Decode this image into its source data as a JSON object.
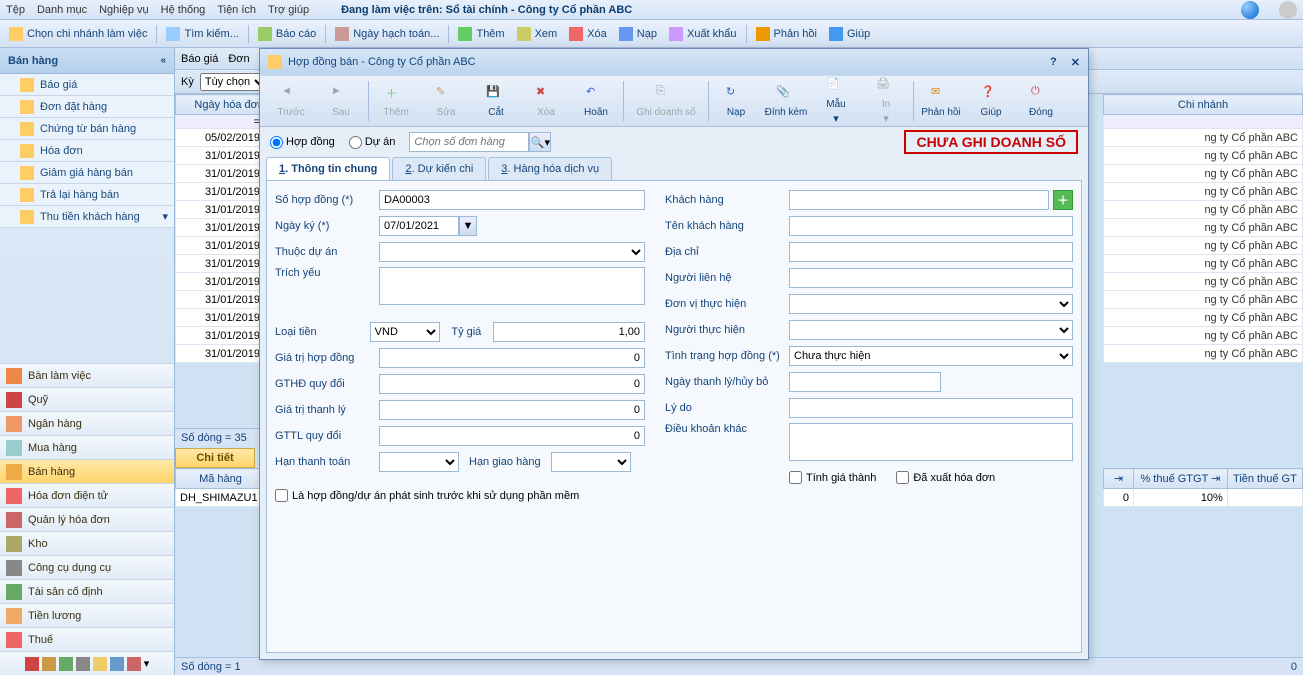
{
  "menubar": {
    "items": [
      "Tệp",
      "Danh mục",
      "Nghiệp vụ",
      "Hệ thống",
      "Tiện ích",
      "Trợ giúp"
    ],
    "context_prefix": "Đang làm việc trên: ",
    "context_value": "Sổ tài chính - Công ty Cổ phần ABC"
  },
  "toolbar": {
    "branch": "Chọn chi nhánh làm việc",
    "search": "Tìm kiếm...",
    "report": "Báo cáo",
    "accounting_date": "Ngày hạch toán...",
    "add": "Thêm",
    "view": "Xem",
    "delete": "Xóa",
    "reload": "Nạp",
    "export": "Xuất khẩu",
    "feedback": "Phản hồi",
    "help": "Giúp"
  },
  "sidebar": {
    "title": "Bán hàng",
    "subs": [
      "Báo giá",
      "Đơn đặt hàng",
      "Chứng từ bán hàng",
      "Hóa đơn",
      "Giảm giá hàng bán",
      "Trả lại hàng bán",
      "Thu tiền khách hàng"
    ],
    "sections": [
      "Bàn làm việc",
      "Quỹ",
      "Ngân hàng",
      "Mua hàng",
      "Bán hàng",
      "Hóa đơn điện tử",
      "Quản lý hóa đơn",
      "Kho",
      "Công cụ dụng cụ",
      "Tài sản cố định",
      "Tiền lương",
      "Thuế"
    ]
  },
  "bg": {
    "filter_tabs": [
      "Báo giá",
      "Đơn"
    ],
    "ky_lbl": "Kỳ",
    "ky_val": "Tùy chọn",
    "col_date": "Ngày hóa đơn",
    "col_branch": "Chi nhánh",
    "dates": [
      "05/02/2019",
      "31/01/2019",
      "31/01/2019",
      "31/01/2019",
      "31/01/2019",
      "31/01/2019",
      "31/01/2019",
      "31/01/2019",
      "31/01/2019",
      "31/01/2019",
      "31/01/2019",
      "31/01/2019",
      "31/01/2019"
    ],
    "branch_val": "ng ty Cổ phần ABC",
    "rowcount": "Số dòng = 35",
    "chi_tiet": "Chi tiết",
    "col_mahang": "Mã hàng",
    "mahang_val": "DH_SHIMAZU1",
    "rowcount2": "Số dòng = 1",
    "col_tax_pct": "% thuế GTGT",
    "col_tax_amt": "Tiền thuế GT",
    "tax_pct_val": "10%",
    "zero": "0"
  },
  "dialog": {
    "title": "Hợp đồng bán - Công ty Cổ phần ABC",
    "tb": {
      "prev": "Trước",
      "next": "Sau",
      "add": "Thêm",
      "edit": "Sửa",
      "cut": "Cắt",
      "delete": "Xóa",
      "undo": "Hoãn",
      "record": "Ghi doanh số",
      "reload": "Nạp",
      "attach": "Đính kèm",
      "template": "Mẫu",
      "print": "In",
      "feedback": "Phản hồi",
      "help": "Giúp",
      "close": "Đóng"
    },
    "opt": {
      "contract": "Hợp đồng",
      "project": "Dự án",
      "search_ph": "Chọn số đơn hàng",
      "stamp": "CHƯA GHI DOANH SỐ"
    },
    "tabs": {
      "t1_pre": "1",
      "t1": ". Thông tin chung",
      "t2_pre": "2",
      "t2": ". Dự kiến chi",
      "t3_pre": "3",
      "t3": ". Hàng hóa dịch vụ"
    },
    "form": {
      "so_hd": "Số hợp đồng (*)",
      "so_hd_val": "DA00003",
      "ngay_ky": "Ngày ký (*)",
      "ngay_ky_val": "07/01/2021",
      "thuoc_da": "Thuộc dự án",
      "trich_yeu": "Trích yếu",
      "loai_tien": "Loại tiền",
      "loai_tien_val": "VND",
      "ty_gia": "Tỷ giá",
      "ty_gia_val": "1,00",
      "gt_hd": "Giá trị hợp đồng",
      "gthd_qd": "GTHĐ quy đổi",
      "gt_tl": "Giá trị thanh lý",
      "gttl_qd": "GTTL quy đổi",
      "han_tt": "Hạn thanh toán",
      "han_gh": "Hạn giao hàng",
      "la_hd": "Là hợp đồng/dự án phát sinh trước khi sử dụng phần mềm",
      "kh": "Khách hàng",
      "ten_kh": "Tên khách hàng",
      "dia_chi": "Địa chỉ",
      "nguoi_lh": "Người liên hệ",
      "dv_th": "Đơn vị thực hiện",
      "nguoi_th": "Người thực hiện",
      "tinh_trang": "Tình trạng hợp đồng (*)",
      "tinh_trang_val": "Chưa thực hiện",
      "ngay_tl": "Ngày thanh lý/hủy bỏ",
      "ly_do": "Lý do",
      "dk_khac": "Điều khoản khác",
      "tinh_gia": "Tính giá thành",
      "da_xuat": "Đã xuất hóa đơn",
      "zero": "0"
    }
  }
}
